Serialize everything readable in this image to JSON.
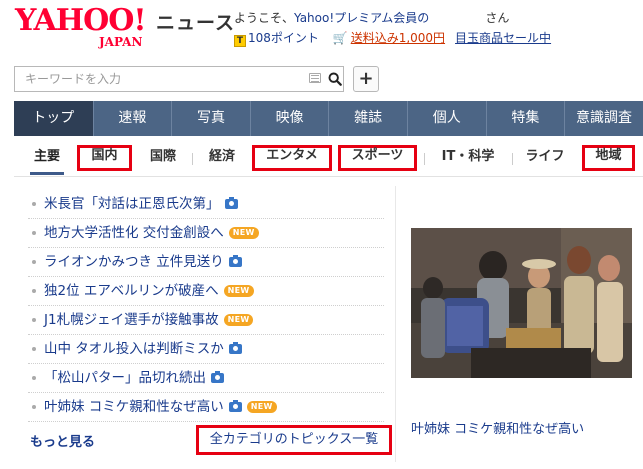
{
  "header": {
    "logo_text": "YAHOO!",
    "logo_sub": "JAPAN",
    "service_name": "ニュース",
    "welcome_prefix": "ようこそ、",
    "welcome_link": "Yahoo!プレミアム会員の",
    "welcome_suffix": "さん",
    "points": "108ポイント",
    "promo_link": "送料込み1,000円",
    "promo_link2": "目玉商品セール中"
  },
  "search": {
    "placeholder": "キーワードを入力",
    "plus_label": "+"
  },
  "main_nav": {
    "tabs": [
      {
        "label": "トップ"
      },
      {
        "label": "速報"
      },
      {
        "label": "写真"
      },
      {
        "label": "映像"
      },
      {
        "label": "雑誌"
      },
      {
        "label": "個人"
      },
      {
        "label": "特集"
      },
      {
        "label": "意識調査"
      }
    ]
  },
  "sub_nav": {
    "items": [
      {
        "label": "主要"
      },
      {
        "label": "国内"
      },
      {
        "label": "国際"
      },
      {
        "label": "経済"
      },
      {
        "label": "エンタメ"
      },
      {
        "label": "スポーツ"
      },
      {
        "label": "IT・科学"
      },
      {
        "label": "ライフ"
      },
      {
        "label": "地域"
      }
    ]
  },
  "news": {
    "items": [
      {
        "title": "米長官「対話は正恩氏次第」",
        "badge": "camera-icon"
      },
      {
        "title": "地方大学活性化 交付金創設へ",
        "badge": "new-badge"
      },
      {
        "title": "ライオンかみつき 立件見送り",
        "badge": "camera-icon"
      },
      {
        "title": "独2位 エアベルリンが破産へ",
        "badge": "new-badge"
      },
      {
        "title": "J1札幌ジェイ選手が接触事故",
        "badge": "new-badge"
      },
      {
        "title": "山中 タオル投入は判断ミスか",
        "badge": "camera-icon"
      },
      {
        "title": "「松山パター」品切れ続出",
        "badge": "camera-icon"
      },
      {
        "title": "叶姉妹 コミケ親和性なぜ高い",
        "badge": "camera-icon+new-badge"
      }
    ],
    "new_label": "NEW",
    "more_label": "もっと見る",
    "all_topics_label": "全カテゴリのトピックス一覧"
  },
  "photo": {
    "caption": "叶姉妹 コミケ親和性なぜ高い"
  },
  "colors": {
    "brand_red": "#ff0033",
    "nav_bg": "#4c6585",
    "nav_active": "#2e3e55",
    "link_blue": "#1a3b8c",
    "highlight_red": "#e60012",
    "new_orange": "#f5a623",
    "camera_blue": "#3776c7"
  }
}
